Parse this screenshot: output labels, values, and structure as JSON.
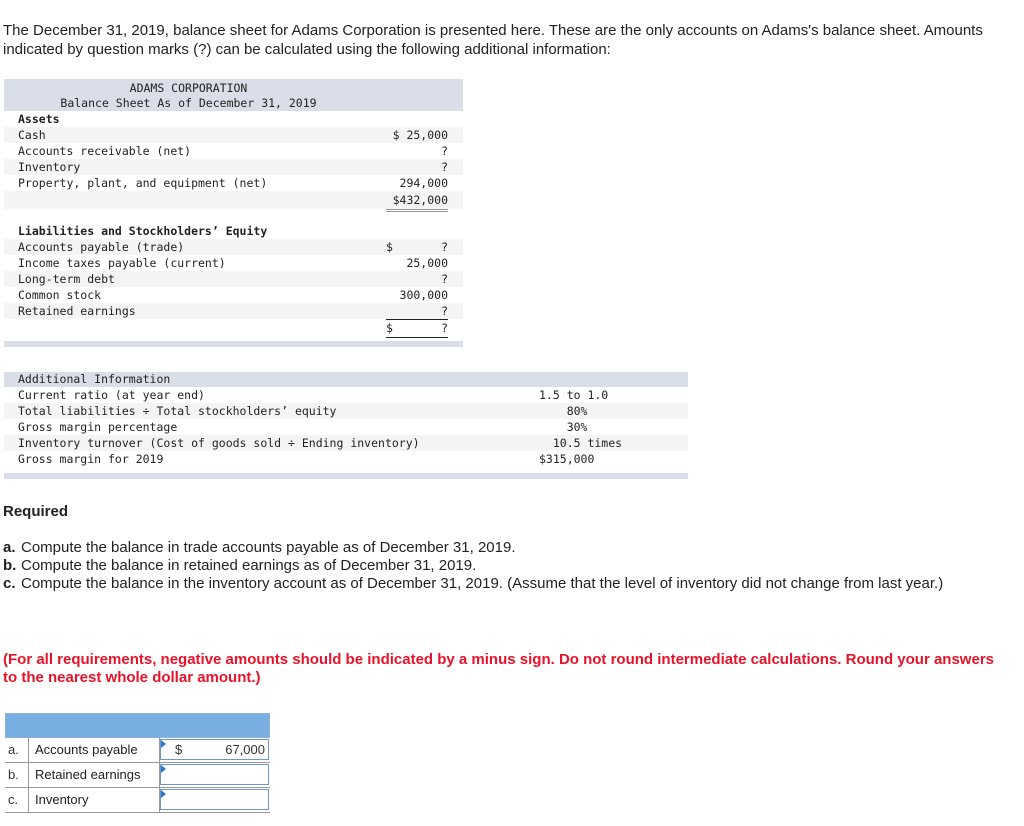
{
  "intro": "The December 31, 2019, balance sheet for Adams Corporation is presented here. These are the only accounts on Adams's balance sheet. Amounts indicated by question marks (?) can be calculated using the following additional information:",
  "balance_sheet": {
    "company": "ADAMS CORPORATION",
    "subtitle": "Balance Sheet As of December 31, 2019",
    "assets_heading": "Assets",
    "assets": [
      {
        "label": "Cash",
        "amount": "$ 25,000"
      },
      {
        "label": "Accounts receivable (net)",
        "amount": "?"
      },
      {
        "label": "Inventory",
        "amount": "?"
      },
      {
        "label": "Property, plant, and equipment (net)",
        "amount": "294,000"
      }
    ],
    "assets_total": "$432,000",
    "liab_heading": "Liabilities and Stockholders’ Equity",
    "liabilities": [
      {
        "label": "Accounts payable (trade)",
        "dollar": "$",
        "amount": "?"
      },
      {
        "label": "Income taxes payable (current)",
        "dollar": "",
        "amount": "25,000"
      },
      {
        "label": "Long-term debt",
        "dollar": "",
        "amount": "?"
      },
      {
        "label": "Common stock",
        "dollar": "",
        "amount": "300,000"
      },
      {
        "label": "Retained earnings",
        "dollar": "",
        "amount": "?"
      }
    ],
    "liab_total_dollar": "$",
    "liab_total": "?"
  },
  "additional_info": {
    "heading": "Additional Information",
    "rows": [
      {
        "label": "Current ratio (at year end)",
        "value": "1.5 to 1.0"
      },
      {
        "label": "Total liabilities ÷ Total stockholders’ equity",
        "value": "    80%"
      },
      {
        "label": "Gross margin percentage",
        "value": "    30%"
      },
      {
        "label": "Inventory turnover (Cost of goods sold ÷ Ending inventory)",
        "value": "  10.5 times"
      },
      {
        "label": "Gross margin for 2019",
        "value": "$315,000"
      }
    ]
  },
  "required": {
    "title": "Required",
    "items": [
      {
        "letter": "a.",
        "text": "Compute the balance in trade accounts payable as of December 31, 2019."
      },
      {
        "letter": "b.",
        "text": "Compute the balance in retained earnings as of December 31, 2019."
      },
      {
        "letter": "c.",
        "text": "Compute the balance in the inventory account as of December 31, 2019. (Assume that the level of inventory did not change from last year.)"
      }
    ]
  },
  "note": "(For all requirements, negative amounts should be indicated by a minus sign. Do not round intermediate calculations. Round your answers to the nearest whole dollar amount.)",
  "answers": [
    {
      "letter": "a.",
      "label": "Accounts payable",
      "currency": "$",
      "value": "67,000"
    },
    {
      "letter": "b.",
      "label": "Retained earnings",
      "currency": "",
      "value": ""
    },
    {
      "letter": "c.",
      "label": "Inventory",
      "currency": "",
      "value": ""
    }
  ]
}
